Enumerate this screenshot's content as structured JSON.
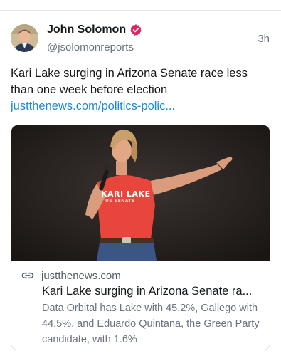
{
  "author": {
    "display_name": "John Solomon",
    "handle": "@jsolomonreports",
    "timestamp": "3h"
  },
  "post": {
    "text": "Kari Lake surging in Arizona Senate race less than one week before election",
    "link_text": "justthenews.com/politics-polic..."
  },
  "link_card": {
    "domain": "justthenews.com",
    "title": "Kari Lake surging in Arizona Senate ra...",
    "description": "Data Orbital has Lake with 45.2%, Gallego with 44.5%, and Eduardo Quintana, the Green Party candidate, with 1.6%",
    "shirt_text": "KARI LAKE",
    "shirt_subtext": "US SENATE"
  },
  "colors": {
    "verified_badge": "#e0245e",
    "link": "#1f8ad0",
    "shirt": "#e8453c"
  },
  "icons": {
    "verified": "verified-badge-icon",
    "link": "link-chain-icon"
  }
}
